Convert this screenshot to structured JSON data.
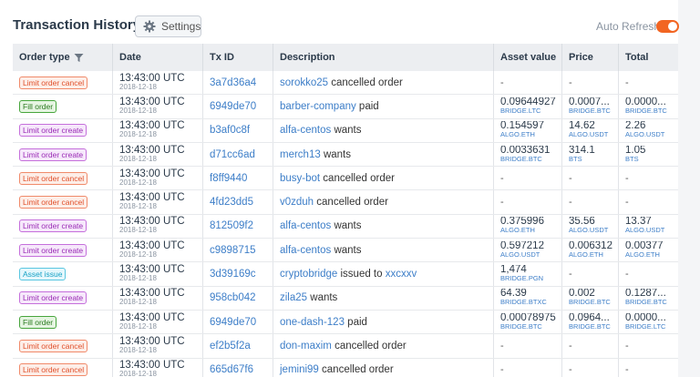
{
  "title": "Transaction History",
  "settings_label": "Settings",
  "auto_refresh_label": "Auto Refresh",
  "auto_refresh_on": true,
  "colors": {
    "accent": "#f26522",
    "link": "#3d7ec8"
  },
  "columns": {
    "order_type": "Order type",
    "date": "Date",
    "tx_id": "Tx ID",
    "description": "Description",
    "asset_value": "Asset value",
    "price": "Price",
    "total": "Total"
  },
  "rows": [
    {
      "type": "Limit order cancel",
      "kind": "cancel",
      "time": "13:43:00 UTC",
      "date": "2018-12-18",
      "tx": "3a7d36a4",
      "actor": "sorokko25",
      "action": " cancelled order",
      "target": "",
      "asset": "-",
      "asset_sym": "",
      "price": "-",
      "price_sym": "",
      "total": "-",
      "total_sym": ""
    },
    {
      "type": "Fill order",
      "kind": "fill",
      "time": "13:43:00 UTC",
      "date": "2018-12-18",
      "tx": "6949de70",
      "actor": "barber-company",
      "action": " paid",
      "target": "",
      "asset": "0.09644927",
      "asset_sym": "BRIDGE.LTC",
      "price": "0.0007...",
      "price_sym": "BRIDGE.BTC",
      "total": "0.0000...",
      "total_sym": "BRIDGE.BTC"
    },
    {
      "type": "Limit order create",
      "kind": "create",
      "time": "13:43:00 UTC",
      "date": "2018-12-18",
      "tx": "b3af0c8f",
      "actor": "alfa-centos",
      "action": " wants",
      "target": "",
      "asset": "0.154597",
      "asset_sym": "ALGO.ETH",
      "price": "14.62",
      "price_sym": "ALGO.USDT",
      "total": "2.26",
      "total_sym": "ALGO.USDT"
    },
    {
      "type": "Limit order create",
      "kind": "create",
      "time": "13:43:00 UTC",
      "date": "2018-12-18",
      "tx": "d71cc6ad",
      "actor": "merch13",
      "action": " wants",
      "target": "",
      "asset": "0.0033631",
      "asset_sym": "BRIDGE.BTC",
      "price": "314.1",
      "price_sym": "BTS",
      "total": "1.05",
      "total_sym": "BTS"
    },
    {
      "type": "Limit order cancel",
      "kind": "cancel",
      "time": "13:43:00 UTC",
      "date": "2018-12-18",
      "tx": "f8ff9440",
      "actor": "busy-bot",
      "action": " cancelled order",
      "target": "",
      "asset": "-",
      "asset_sym": "",
      "price": "-",
      "price_sym": "",
      "total": "-",
      "total_sym": ""
    },
    {
      "type": "Limit order cancel",
      "kind": "cancel",
      "time": "13:43:00 UTC",
      "date": "2018-12-18",
      "tx": "4fd23dd5",
      "actor": "v0zduh",
      "action": " cancelled order",
      "target": "",
      "asset": "-",
      "asset_sym": "",
      "price": "-",
      "price_sym": "",
      "total": "-",
      "total_sym": ""
    },
    {
      "type": "Limit order create",
      "kind": "create",
      "time": "13:43:00 UTC",
      "date": "2018-12-18",
      "tx": "812509f2",
      "actor": "alfa-centos",
      "action": " wants",
      "target": "",
      "asset": "0.375996",
      "asset_sym": "ALGO.ETH",
      "price": "35.56",
      "price_sym": "ALGO.USDT",
      "total": "13.37",
      "total_sym": "ALGO.USDT"
    },
    {
      "type": "Limit order create",
      "kind": "create",
      "time": "13:43:00 UTC",
      "date": "2018-12-18",
      "tx": "c9898715",
      "actor": "alfa-centos",
      "action": " wants",
      "target": "",
      "asset": "0.597212",
      "asset_sym": "ALGO.USDT",
      "price": "0.006312",
      "price_sym": "ALGO.ETH",
      "total": "0.00377",
      "total_sym": "ALGO.ETH"
    },
    {
      "type": "Asset issue",
      "kind": "issue",
      "time": "13:43:00 UTC",
      "date": "2018-12-18",
      "tx": "3d39169c",
      "actor": "cryptobridge",
      "action": " issued to ",
      "target": "xxcxxv",
      "asset": "1,474",
      "asset_sym": "BRIDGE.PGN",
      "price": "-",
      "price_sym": "",
      "total": "-",
      "total_sym": ""
    },
    {
      "type": "Limit order create",
      "kind": "create",
      "time": "13:43:00 UTC",
      "date": "2018-12-18",
      "tx": "958cb042",
      "actor": "zila25",
      "action": " wants",
      "target": "",
      "asset": "64.39",
      "asset_sym": "BRIDGE.BTXC",
      "price": "0.002",
      "price_sym": "BRIDGE.BTC",
      "total": "0.1287...",
      "total_sym": "BRIDGE.BTC"
    },
    {
      "type": "Fill order",
      "kind": "fill",
      "time": "13:43:00 UTC",
      "date": "2018-12-18",
      "tx": "6949de70",
      "actor": "one-dash-123",
      "action": " paid",
      "target": "",
      "asset": "0.00078975",
      "asset_sym": "BRIDGE.BTC",
      "price": "0.0964...",
      "price_sym": "BRIDGE.BTC",
      "total": "0.0000...",
      "total_sym": "BRIDGE.LTC"
    },
    {
      "type": "Limit order cancel",
      "kind": "cancel",
      "time": "13:43:00 UTC",
      "date": "2018-12-18",
      "tx": "ef2b5f2a",
      "actor": "don-maxim",
      "action": " cancelled order",
      "target": "",
      "asset": "-",
      "asset_sym": "",
      "price": "-",
      "price_sym": "",
      "total": "-",
      "total_sym": ""
    },
    {
      "type": "Limit order cancel",
      "kind": "cancel",
      "time": "13:43:00 UTC",
      "date": "2018-12-18",
      "tx": "665d67f6",
      "actor": "jemini99",
      "action": " cancelled order",
      "target": "",
      "asset": "-",
      "asset_sym": "",
      "price": "-",
      "price_sym": "",
      "total": "-",
      "total_sym": ""
    }
  ]
}
